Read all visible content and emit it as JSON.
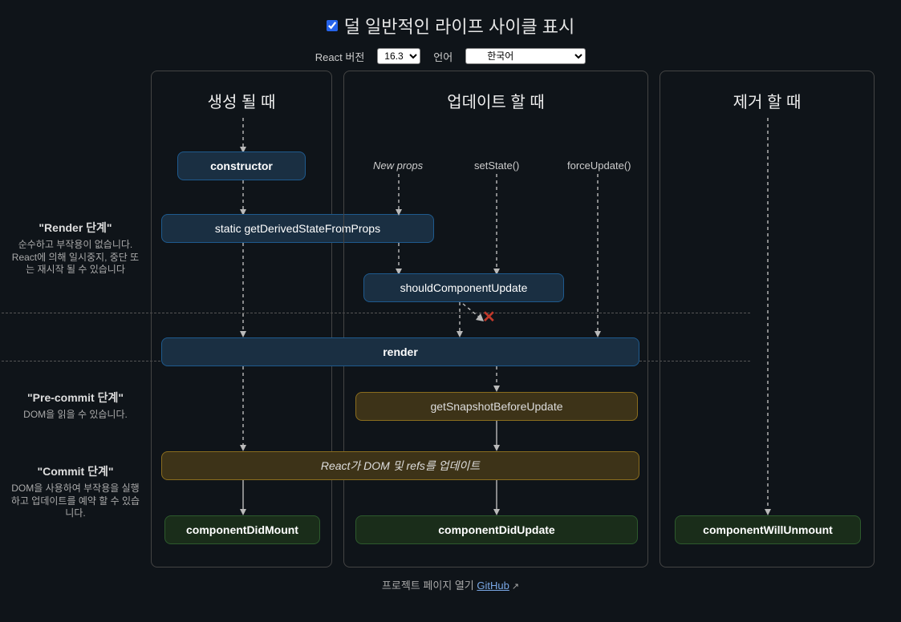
{
  "header": {
    "checkbox_label": "덜 일반적인 라이프 사이클 표시",
    "version_label": "React 버전",
    "version_value": "16.3",
    "lang_label": "언어",
    "lang_value": "한국어"
  },
  "columns": {
    "mounting": "생성 될 때",
    "updating": "업데이트 할 때",
    "unmounting": "제거 할 때"
  },
  "phases": {
    "render": {
      "title": "\"Render 단계\"",
      "desc": "순수하고 부작용이 없습니다. React에 의해 일시중지, 중단 또는 재시작 될 수 있습니다"
    },
    "precommit": {
      "title": "\"Pre-commit 단계\"",
      "desc": "DOM을 읽을 수 있습니다."
    },
    "commit": {
      "title": "\"Commit 단계\"",
      "desc": "DOM을 사용하여 부작용을 실행하고 업데이트를 예약 할 수 있습니다."
    }
  },
  "nodes": {
    "constructor": "constructor",
    "gdsfp": "static getDerivedStateFromProps",
    "scu": "shouldComponentUpdate",
    "render": "render",
    "gsbu": "getSnapshotBeforeUpdate",
    "dom_update": "React가 DOM 및 refs를 업데이트",
    "cdm": "componentDidMount",
    "cdu": "componentDidUpdate",
    "cwu": "componentWillUnmount"
  },
  "triggers": {
    "new_props": "New props",
    "set_state": "setState()",
    "force_update": "forceUpdate()"
  },
  "footer": {
    "text": "프로젝트 페이지 열기 ",
    "link": "GitHub"
  }
}
